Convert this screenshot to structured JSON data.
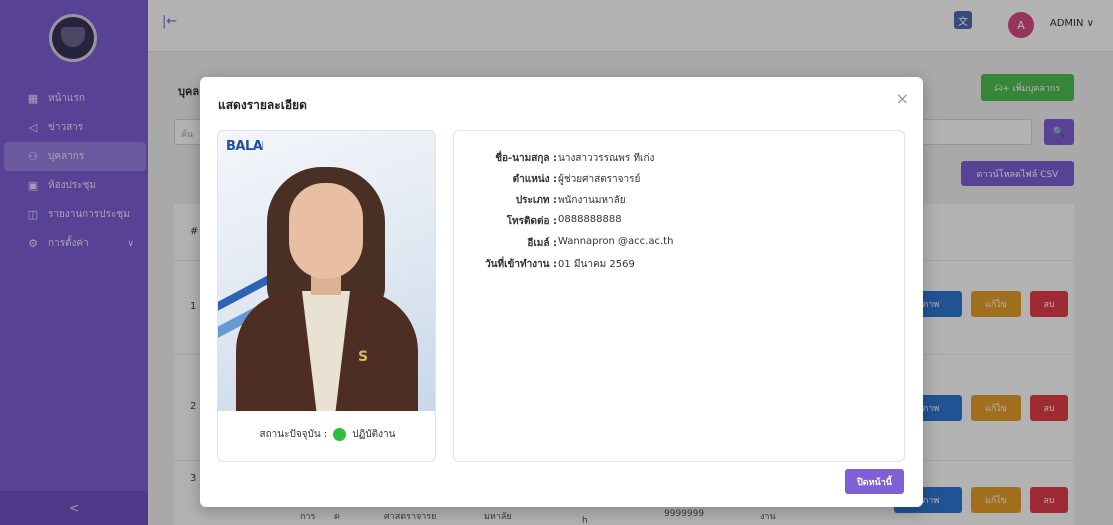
{
  "topbar": {
    "user_avatar_letter": "A",
    "user_name": "ADMIN ∨",
    "collapse_glyph": "|←"
  },
  "sidebar": {
    "items": [
      {
        "icon": "▦",
        "label": "หน้าแรก"
      },
      {
        "icon": "◁",
        "label": "ข่าวสาร"
      },
      {
        "icon": "⚇",
        "label": "บุคลากร"
      },
      {
        "icon": "▣",
        "label": "ห้องประชุม"
      },
      {
        "icon": "◫",
        "label": "รายงานการประชุม"
      },
      {
        "icon": "⚙",
        "label": "การตั้งค่า",
        "chevron": "∨"
      }
    ],
    "collapse_glyph": "<"
  },
  "background": {
    "page_title": "บุคล",
    "add_button": "ᗣ+ เพิ่มบุคลากร",
    "search_placeholder": "ค้น",
    "search_icon": "🔍",
    "csv_button": "ดาวน์โหลดไฟล์ CSV",
    "header_number": "#",
    "rows": [
      {
        "num": "1",
        "img_btn": "ปภาพ",
        "edit_btn": "แก้ไข",
        "del_btn": "ลบ"
      },
      {
        "num": "2",
        "img_btn": "ปภาพ",
        "edit_btn": "แก้ไข",
        "del_btn": "ลบ"
      },
      {
        "num": "3",
        "img_btn": "ปภาพ",
        "edit_btn": "แก้ไข",
        "del_btn": "ลบ",
        "cells": [
          "การ",
          "ด",
          "ศาสตราจารย",
          "มหาลัย",
          "h",
          "9999999",
          "งาน"
        ]
      }
    ]
  },
  "modal": {
    "title": "แสดงรายละเอียด",
    "close_glyph": "×",
    "photo_brand": "BALA",
    "status_label": "สถานะปัจจุบัน :",
    "status_value": "ปฏิบัติงาน",
    "fields": [
      {
        "label": "ชื่อ-นามสกุล :",
        "value": "นางสาววรรณพร ทีเก่ง"
      },
      {
        "label": "ตำแหน่ง :",
        "value": "ผู้ช่วยศาสตราจารย์"
      },
      {
        "label": "ประเภท :",
        "value": "พนักงานมหาลัย"
      },
      {
        "label": "โทรติดต่อ :",
        "value": "0888888888"
      },
      {
        "label": "อีเมล์ :",
        "value": "Wannapron @acc.ac.th"
      },
      {
        "label": "วันที่เข้าทำงาน :",
        "value": "01 มีนาคม 2569"
      }
    ],
    "close_page_button": "ปิดหน้านี้"
  },
  "colors": {
    "sidebar": "#7f5fd6",
    "primary": "#7f5fd6",
    "success": "#4fbf52",
    "status_active": "#2ebd3c",
    "danger": "#e23d4a",
    "warning": "#e5a12b",
    "info": "#2f78d6"
  }
}
